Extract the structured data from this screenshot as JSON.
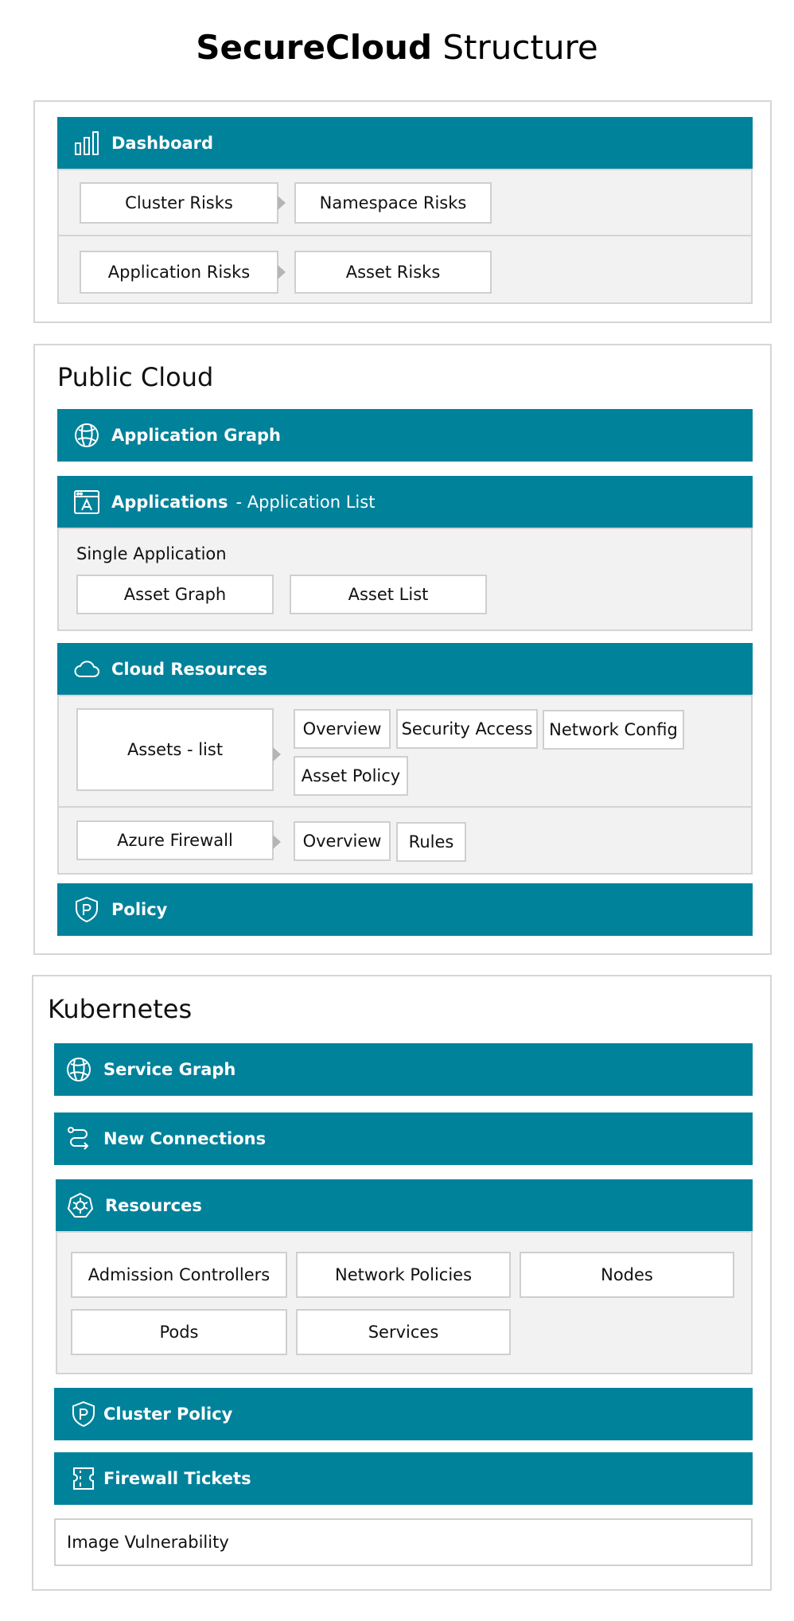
{
  "title": {
    "bold": "SecureCloud",
    "rest": " Structure"
  },
  "dashboard": {
    "label": "Dashboard",
    "icon": "bar-chart-icon",
    "row1": [
      "Cluster Risks",
      "Namespace Risks"
    ],
    "row2": [
      "Application Risks",
      "Asset Risks"
    ]
  },
  "public_cloud": {
    "heading": "Public Cloud",
    "application_graph": {
      "label": "Application Graph",
      "icon": "graph-globe-icon"
    },
    "applications": {
      "label": "Applications",
      "sublabel": "- Application List",
      "icon": "application-icon",
      "single_application": "Single Application",
      "items": [
        "Asset Graph",
        "Asset List"
      ]
    },
    "cloud_resources": {
      "label": "Cloud Resources",
      "icon": "cloud-icon",
      "assets_list": "Assets - list",
      "assets_children": [
        "Overview",
        "Security Access",
        "Network Config",
        "Asset Policy"
      ],
      "azure_firewall": "Azure Firewall",
      "firewall_children": [
        "Overview",
        "Rules"
      ]
    },
    "policy": {
      "label": "Policy",
      "icon": "policy-shield-icon"
    }
  },
  "kubernetes": {
    "heading": "Kubernetes",
    "service_graph": {
      "label": "Service Graph",
      "icon": "graph-globe-icon"
    },
    "new_connections": {
      "label": "New Connections",
      "icon": "connections-icon"
    },
    "resources": {
      "label": "Resources",
      "icon": "helm-wheel-icon",
      "items": [
        "Admission Controllers",
        "Network Policies",
        "Nodes",
        "Pods",
        "Services"
      ]
    },
    "cluster_policy": {
      "label": "Cluster Policy",
      "icon": "policy-shield-icon"
    },
    "firewall_tickets": {
      "label": "Firewall Tickets",
      "icon": "ticket-icon"
    },
    "image_vulnerability": "Image Vulnerability"
  },
  "colors": {
    "bar": "#00829b",
    "grey_panel": "#f2f2f2",
    "border": "#d4d4d4"
  }
}
